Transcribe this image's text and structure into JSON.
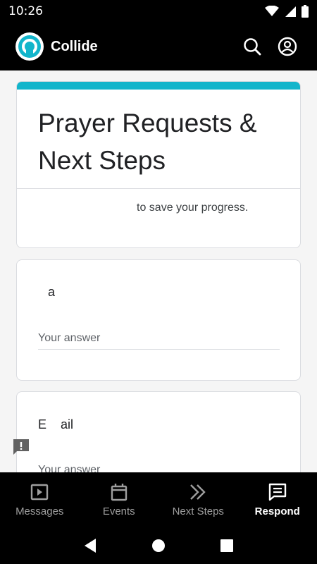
{
  "status_bar": {
    "time": "10:26"
  },
  "app_bar": {
    "title": "Collide"
  },
  "form": {
    "title": "Prayer Requests & Next Steps",
    "save_note": "to save your progress."
  },
  "questions": [
    {
      "label": "a",
      "placeholder": "Your answer"
    },
    {
      "label": "E    ail",
      "placeholder": "Your answer"
    }
  ],
  "bottom_nav": {
    "items": [
      {
        "label": "Messages",
        "icon": "play-box-icon"
      },
      {
        "label": "Events",
        "icon": "calendar-icon"
      },
      {
        "label": "Next Steps",
        "icon": "double-chevron-icon"
      },
      {
        "label": "Respond",
        "icon": "feedback-icon"
      }
    ],
    "active": "Respond"
  },
  "colors": {
    "accent": "#12b5cb",
    "bar": "#000000",
    "inactive": "#9e9e9e"
  }
}
